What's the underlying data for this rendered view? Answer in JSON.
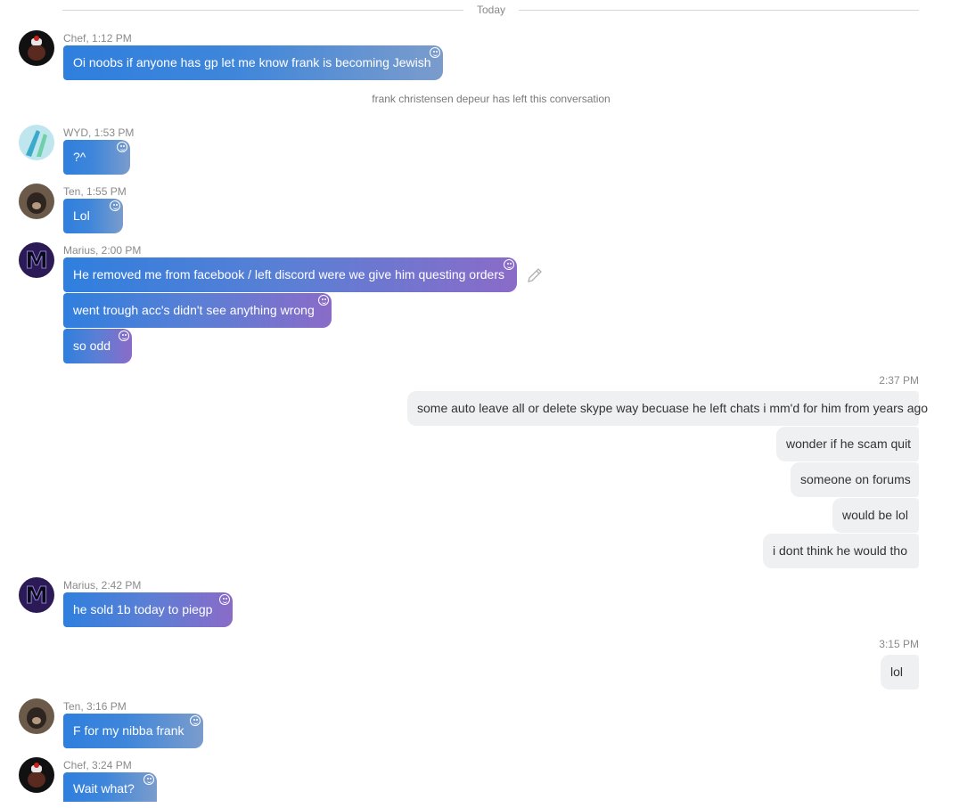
{
  "divider": {
    "label": "Today"
  },
  "system_notice": "frank christensen depeur has left this conversation",
  "messages": [
    {
      "meta": "Chef, 1:12 PM",
      "bubbles": [
        "Oi noobs if anyone has gp let me know frank is becoming Jewish"
      ]
    },
    {
      "meta": "WYD, 1:53 PM",
      "bubbles": [
        "?^"
      ]
    },
    {
      "meta": "Ten, 1:55 PM",
      "bubbles": [
        "Lol"
      ]
    },
    {
      "meta": "Marius, 2:00 PM",
      "bubbles": [
        "He removed me from facebook / left discord were we give him questing orders",
        "went trough acc's didn't see anything wrong",
        "so odd"
      ]
    },
    {
      "meta": "2:37 PM",
      "bubbles": [
        "some auto leave all or delete skype way becuase he left chats i mm'd for him from years ago",
        "wonder if he scam quit",
        "someone on forums",
        "would be lol",
        "i dont think he would tho"
      ]
    },
    {
      "meta": "Marius, 2:42 PM",
      "bubbles": [
        "he sold 1b today to piegp"
      ]
    },
    {
      "meta": "3:15 PM",
      "bubbles": [
        "lol"
      ]
    },
    {
      "meta": "Ten, 3:16 PM",
      "bubbles": [
        "F for my nibba frank"
      ]
    },
    {
      "meta": "Chef, 3:24 PM",
      "bubbles": [
        "Wait what?"
      ]
    }
  ],
  "icons": {
    "reaction": "smiley-icon",
    "edit": "pencil-icon"
  },
  "colors": {
    "incoming_start": "#2f7fde",
    "incoming_end_blue": "#7b9ccc",
    "incoming_end_purple": "#8a6bc8",
    "outgoing_bg": "#eef0f2"
  }
}
